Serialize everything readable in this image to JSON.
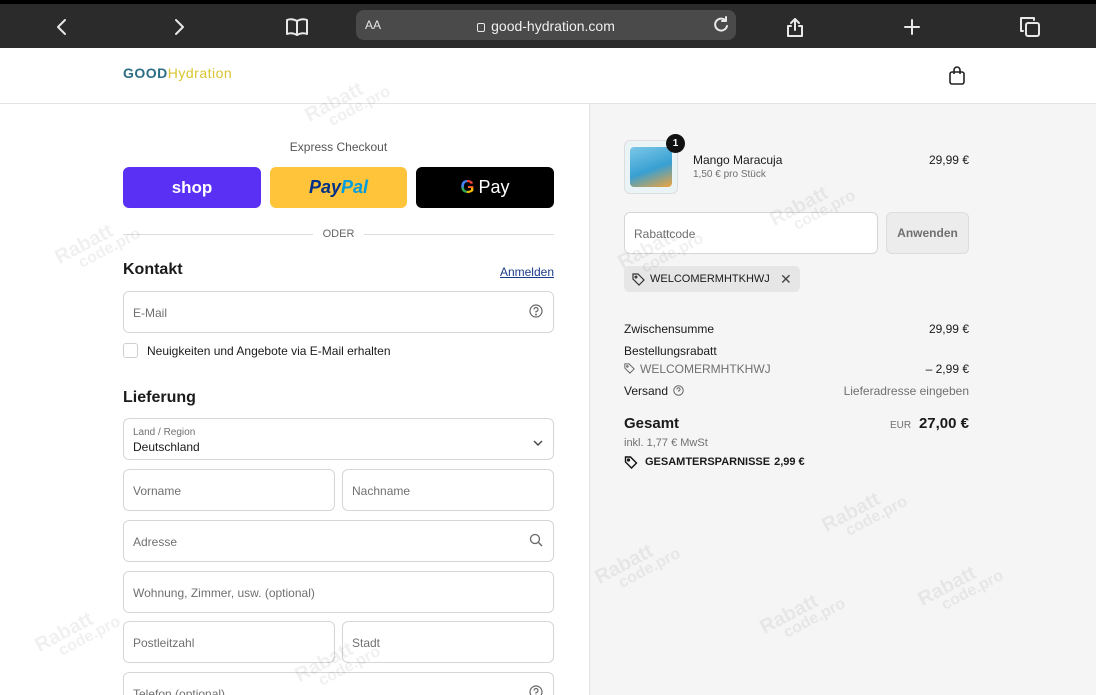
{
  "browser": {
    "aa_label": "AA",
    "url": "good-hydration.com"
  },
  "site": {
    "logo_part1": "GOOD",
    "logo_part2": "Hydration"
  },
  "express": {
    "title": "Express Checkout",
    "shop_label": "shop",
    "paypal_part1": "Pay",
    "paypal_part2": "Pal",
    "gpay_g": "G",
    "gpay_label": "Pay",
    "divider": "ODER"
  },
  "contact": {
    "heading": "Kontakt",
    "login_link": "Anmelden",
    "email_placeholder": "E-Mail",
    "newsletter_label": "Neuigkeiten und Angebote via E-Mail erhalten"
  },
  "delivery": {
    "heading": "Lieferung",
    "country_label": "Land / Region",
    "country_value": "Deutschland",
    "first_name": "Vorname",
    "last_name": "Nachname",
    "address": "Adresse",
    "apartment": "Wohnung, Zimmer, usw. (optional)",
    "zip": "Postleitzahl",
    "city": "Stadt",
    "phone": "Telefon (optional)"
  },
  "summary": {
    "product": {
      "name": "Mango Maracuja",
      "unit_price": "1,50 € pro Stück",
      "price": "29,99 €",
      "quantity": "1"
    },
    "discount_placeholder": "Rabattcode",
    "apply_label": "Anwenden",
    "applied_code": "WELCOMERMHTKHWJ",
    "subtotal_label": "Zwischensumme",
    "subtotal_value": "29,99 €",
    "order_discount_label": "Bestellungsrabatt",
    "order_discount_code": "WELCOMERMHTKHWJ",
    "order_discount_value": "– 2,99 €",
    "shipping_label": "Versand",
    "shipping_value": "Lieferadresse eingeben",
    "total_label": "Gesamt",
    "currency": "EUR",
    "total_value": "27,00 €",
    "vat_note": "inkl. 1,77 € MwSt",
    "savings_label": "GESAMTERSPARNISSE",
    "savings_value": "2,99 €"
  },
  "watermark": {
    "line1": "Rabatt",
    "line2": "code.pro"
  },
  "colors": {
    "shop_pay": "#5a31f4",
    "paypal": "#ffc439",
    "gpay": "#000000",
    "brand_teal": "#2d6e86",
    "brand_yellow": "#d9c531"
  }
}
